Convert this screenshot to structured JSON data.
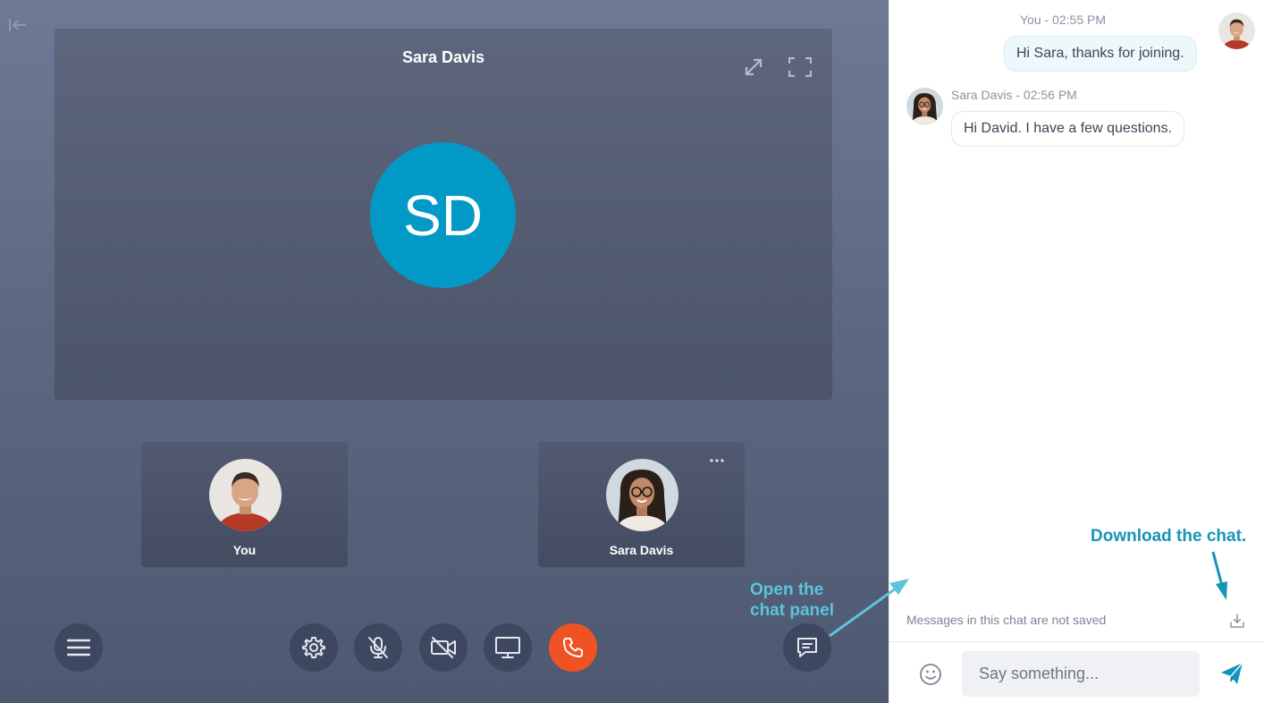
{
  "colors": {
    "accent": "#0399c7",
    "hangup": "#f05323",
    "annotation_light": "#5bc4dd",
    "annotation_dark": "#1595b8"
  },
  "call": {
    "main_participant_name": "Sara Davis",
    "main_participant_initials": "SD",
    "participants": [
      {
        "label": "You",
        "icon": "avatar-man"
      },
      {
        "label": "Sara Davis",
        "icon": "avatar-woman"
      }
    ],
    "controls": [
      {
        "name": "menu",
        "icon": "hamburger-icon"
      },
      {
        "name": "settings",
        "icon": "gear-icon"
      },
      {
        "name": "microphone",
        "icon": "mic-off-icon"
      },
      {
        "name": "camera",
        "icon": "video-off-icon"
      },
      {
        "name": "screen-share",
        "icon": "monitor-icon"
      },
      {
        "name": "hang-up",
        "icon": "phone-icon"
      },
      {
        "name": "chat",
        "icon": "chat-icon"
      }
    ]
  },
  "annotations": {
    "chat_line1": "Open the",
    "chat_line2": "chat panel",
    "download": "Download the chat."
  },
  "chat": {
    "messages": [
      {
        "meta": "You - 02:55 PM",
        "text": "Hi Sara, thanks for joining.",
        "direction": "out"
      },
      {
        "meta": "Sara Davis - 02:56 PM",
        "text": "Hi David. I have a few questions.",
        "direction": "in"
      }
    ],
    "not_saved_notice": "Messages in this chat are not saved",
    "input_placeholder": "Say something..."
  }
}
